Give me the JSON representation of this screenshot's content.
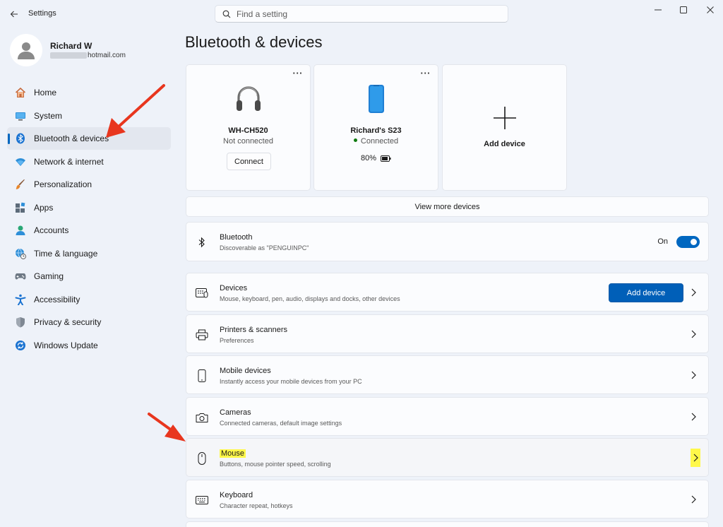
{
  "app": {
    "title": "Settings",
    "search_placeholder": "Find a setting"
  },
  "profile": {
    "name": "Richard W",
    "email_domain": "hotmail.com"
  },
  "sidebar": {
    "items": [
      {
        "label": "Home",
        "icon": "home-icon"
      },
      {
        "label": "System",
        "icon": "system-icon"
      },
      {
        "label": "Bluetooth & devices",
        "icon": "bluetooth-icon",
        "active": true
      },
      {
        "label": "Network & internet",
        "icon": "wifi-icon"
      },
      {
        "label": "Personalization",
        "icon": "brush-icon"
      },
      {
        "label": "Apps",
        "icon": "apps-icon"
      },
      {
        "label": "Accounts",
        "icon": "accounts-icon"
      },
      {
        "label": "Time & language",
        "icon": "globe-clock-icon"
      },
      {
        "label": "Gaming",
        "icon": "gamepad-icon"
      },
      {
        "label": "Accessibility",
        "icon": "accessibility-icon"
      },
      {
        "label": "Privacy & security",
        "icon": "shield-icon"
      },
      {
        "label": "Windows Update",
        "icon": "update-icon"
      }
    ]
  },
  "main": {
    "title": "Bluetooth & devices",
    "devices": [
      {
        "name": "WH-CH520",
        "status": "Not connected",
        "action": "Connect",
        "more": "···",
        "icon": "headphones-icon"
      },
      {
        "name": "Richard's S23",
        "status": "Connected",
        "battery": "80%",
        "more": "···",
        "icon": "phone-icon"
      }
    ],
    "add_device_card": {
      "label": "Add device"
    },
    "view_more": "View more devices",
    "bluetooth": {
      "title": "Bluetooth",
      "subtitle": "Discoverable as \"PENGUINPC\"",
      "state": "On"
    },
    "rows": [
      {
        "title": "Devices",
        "subtitle": "Mouse, keyboard, pen, audio, displays and docks, other devices",
        "button": "Add device",
        "icon": "devices-icon"
      },
      {
        "title": "Printers & scanners",
        "subtitle": "Preferences",
        "icon": "printer-icon"
      },
      {
        "title": "Mobile devices",
        "subtitle": "Instantly access your mobile devices from your PC",
        "icon": "mobile-icon"
      },
      {
        "title": "Cameras",
        "subtitle": "Connected cameras, default image settings",
        "icon": "camera-icon"
      },
      {
        "title": "Mouse",
        "subtitle": "Buttons, mouse pointer speed, scrolling",
        "icon": "mouse-icon",
        "highlighted": true
      },
      {
        "title": "Keyboard",
        "subtitle": "Character repeat, hotkeys",
        "icon": "keyboard-icon"
      }
    ]
  },
  "colors": {
    "accent": "#0067c0",
    "highlight": "#fff84a",
    "annotation_arrow": "#e8361e",
    "background": "#eef2f9",
    "card": "#fbfcfe"
  }
}
